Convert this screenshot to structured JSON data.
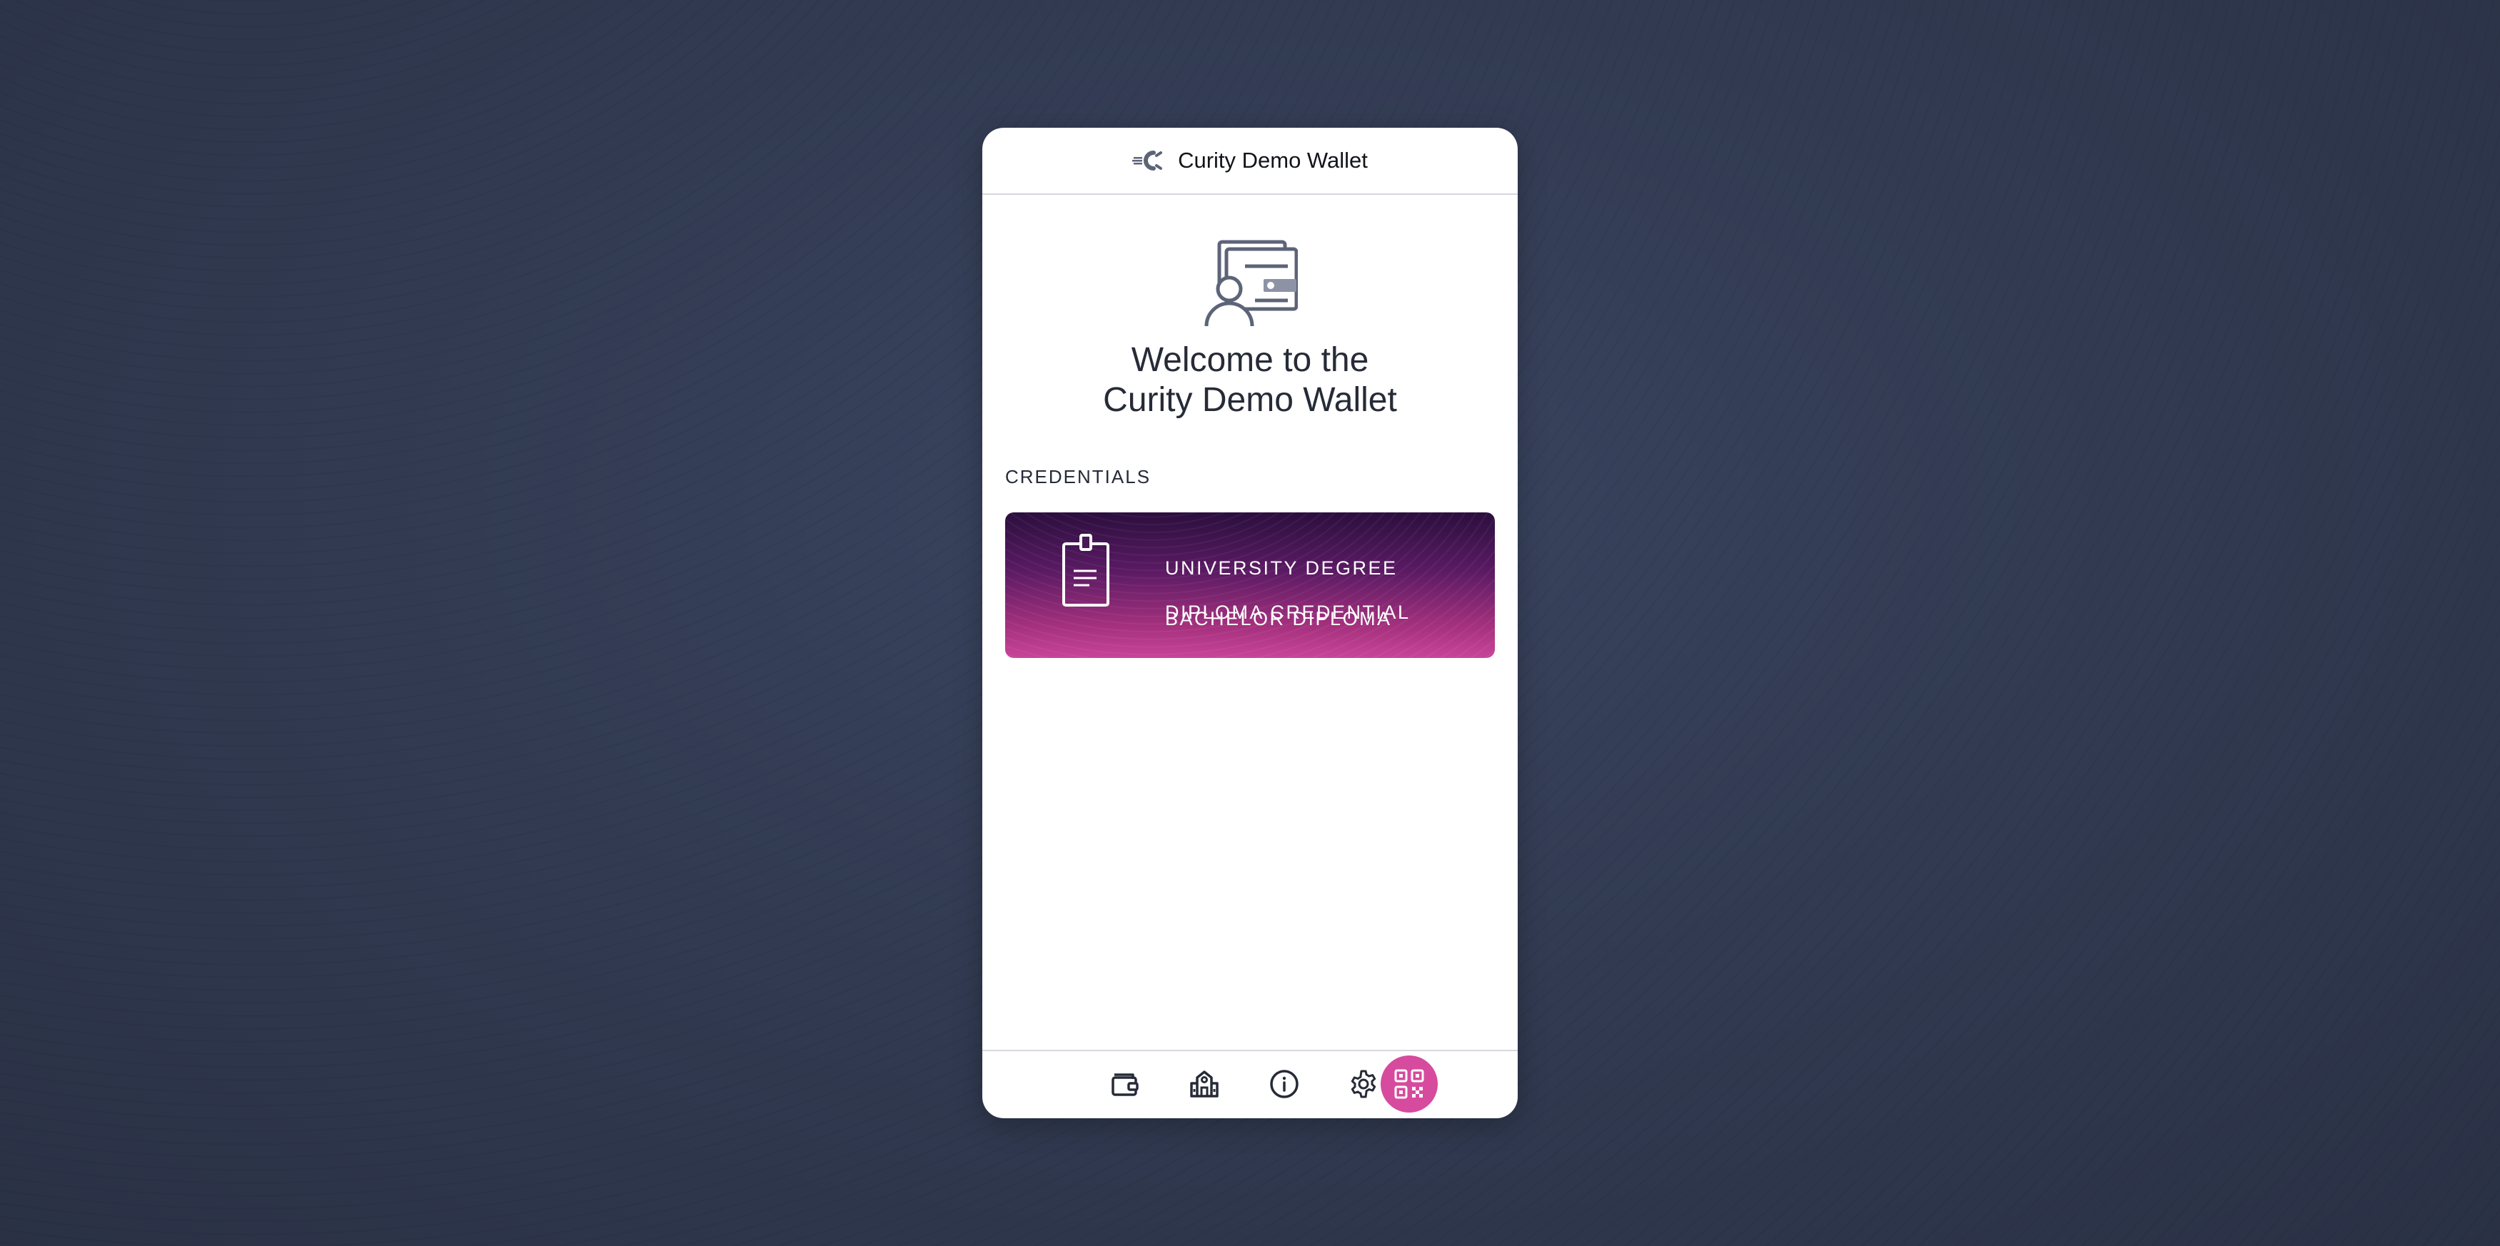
{
  "app": {
    "title": "Curity Demo Wallet"
  },
  "welcome": {
    "line1": "Welcome to the",
    "line2": "Curity Demo Wallet"
  },
  "credentials": {
    "section_label": "CREDENTIALS",
    "items": [
      {
        "type_line1": "UNIVERSITY DEGREE",
        "type_line2": "DIPLOMA CREDENTIAL",
        "name": "BACHELOR DIPLOMA",
        "icon": "clipboard-document-icon"
      }
    ]
  },
  "nav": {
    "items": [
      {
        "icon": "wallet-icon"
      },
      {
        "icon": "institution-icon"
      },
      {
        "icon": "info-icon"
      },
      {
        "icon": "gear-icon"
      },
      {
        "icon": "qr-code-icon"
      }
    ]
  },
  "colors": {
    "accent": "#d64b9e",
    "text": "#262b37",
    "icon": "#5d6478",
    "background": "#323b52"
  }
}
